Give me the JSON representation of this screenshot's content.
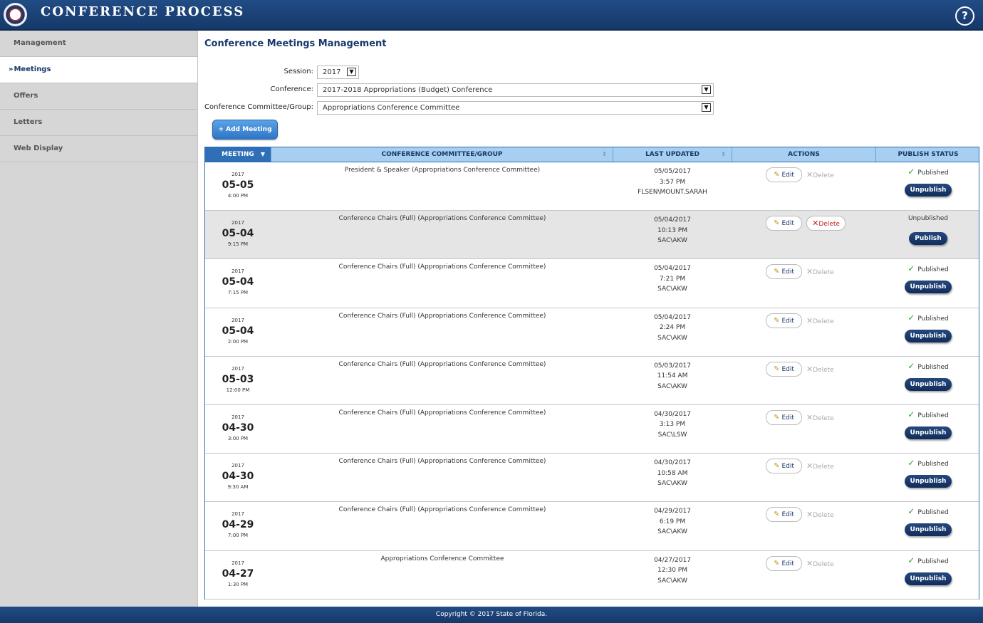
{
  "header": {
    "title": "CONFERENCE PROCESS",
    "help": "?"
  },
  "sidebar": {
    "items": [
      {
        "label": "Management"
      },
      {
        "label": "Meetings",
        "marker": "»"
      },
      {
        "label": "Offers"
      },
      {
        "label": "Letters"
      },
      {
        "label": "Web Display"
      }
    ]
  },
  "main": {
    "title": "Conference Meetings Management",
    "session_label": "Session:",
    "session_value": "2017",
    "conference_label": "Conference:",
    "conference_value": "2017-2018 Appropriations (Budget) Conference",
    "committee_label": "Conference Committee/Group:",
    "committee_value": "Appropriations Conference Committee",
    "add_button": "+ Add Meeting"
  },
  "table": {
    "columns": [
      "MEETING",
      "CONFERENCE COMMITTEE/GROUP",
      "LAST UPDATED",
      "ACTIONS",
      "PUBLISH STATUS"
    ],
    "sort_down": "▼",
    "sort_updown": "⇕",
    "edit_label": "Edit",
    "delete_label": "Delete",
    "rows": [
      {
        "year": "2017",
        "day": "05-05",
        "time": "4:00 PM",
        "committee": "President & Speaker (Appropriations Conference Committee)",
        "updated_date": "05/05/2017",
        "updated_time": "3:57 PM",
        "updated_by": "FLSEN\\MOUNT.SARAH",
        "status": "Published",
        "button": "Unpublish",
        "delete_enabled": false
      },
      {
        "year": "2017",
        "day": "05-04",
        "time": "9:15 PM",
        "committee": "Conference Chairs (Full) (Appropriations Conference Committee)",
        "updated_date": "05/04/2017",
        "updated_time": "10:13 PM",
        "updated_by": "SAC\\AKW",
        "status": "Unpublished",
        "button": "Publish",
        "delete_enabled": true
      },
      {
        "year": "2017",
        "day": "05-04",
        "time": "7:15 PM",
        "committee": "Conference Chairs (Full) (Appropriations Conference Committee)",
        "updated_date": "05/04/2017",
        "updated_time": "7:21 PM",
        "updated_by": "SAC\\AKW",
        "status": "Published",
        "button": "Unpublish",
        "delete_enabled": false
      },
      {
        "year": "2017",
        "day": "05-04",
        "time": "2:00 PM",
        "committee": "Conference Chairs (Full) (Appropriations Conference Committee)",
        "updated_date": "05/04/2017",
        "updated_time": "2:24 PM",
        "updated_by": "SAC\\AKW",
        "status": "Published",
        "button": "Unpublish",
        "delete_enabled": false
      },
      {
        "year": "2017",
        "day": "05-03",
        "time": "12:00 PM",
        "committee": "Conference Chairs (Full) (Appropriations Conference Committee)",
        "updated_date": "05/03/2017",
        "updated_time": "11:54 AM",
        "updated_by": "SAC\\AKW",
        "status": "Published",
        "button": "Unpublish",
        "delete_enabled": false
      },
      {
        "year": "2017",
        "day": "04-30",
        "time": "3:00 PM",
        "committee": "Conference Chairs (Full) (Appropriations Conference Committee)",
        "updated_date": "04/30/2017",
        "updated_time": "3:13 PM",
        "updated_by": "SAC\\LSW",
        "status": "Published",
        "button": "Unpublish",
        "delete_enabled": false
      },
      {
        "year": "2017",
        "day": "04-30",
        "time": "9:30 AM",
        "committee": "Conference Chairs (Full) (Appropriations Conference Committee)",
        "updated_date": "04/30/2017",
        "updated_time": "10:58 AM",
        "updated_by": "SAC\\AKW",
        "status": "Published",
        "button": "Unpublish",
        "delete_enabled": false
      },
      {
        "year": "2017",
        "day": "04-29",
        "time": "7:00 PM",
        "committee": "Conference Chairs (Full) (Appropriations Conference Committee)",
        "updated_date": "04/29/2017",
        "updated_time": "6:19 PM",
        "updated_by": "SAC\\AKW",
        "status": "Published",
        "button": "Unpublish",
        "delete_enabled": false
      },
      {
        "year": "2017",
        "day": "04-27",
        "time": "1:30 PM",
        "committee": "Appropriations Conference Committee",
        "updated_date": "04/27/2017",
        "updated_time": "12:30 PM",
        "updated_by": "SAC\\AKW",
        "status": "Published",
        "button": "Unpublish",
        "delete_enabled": false
      }
    ]
  },
  "footer": {
    "text": "Copyright © 2017 State of Florida."
  }
}
